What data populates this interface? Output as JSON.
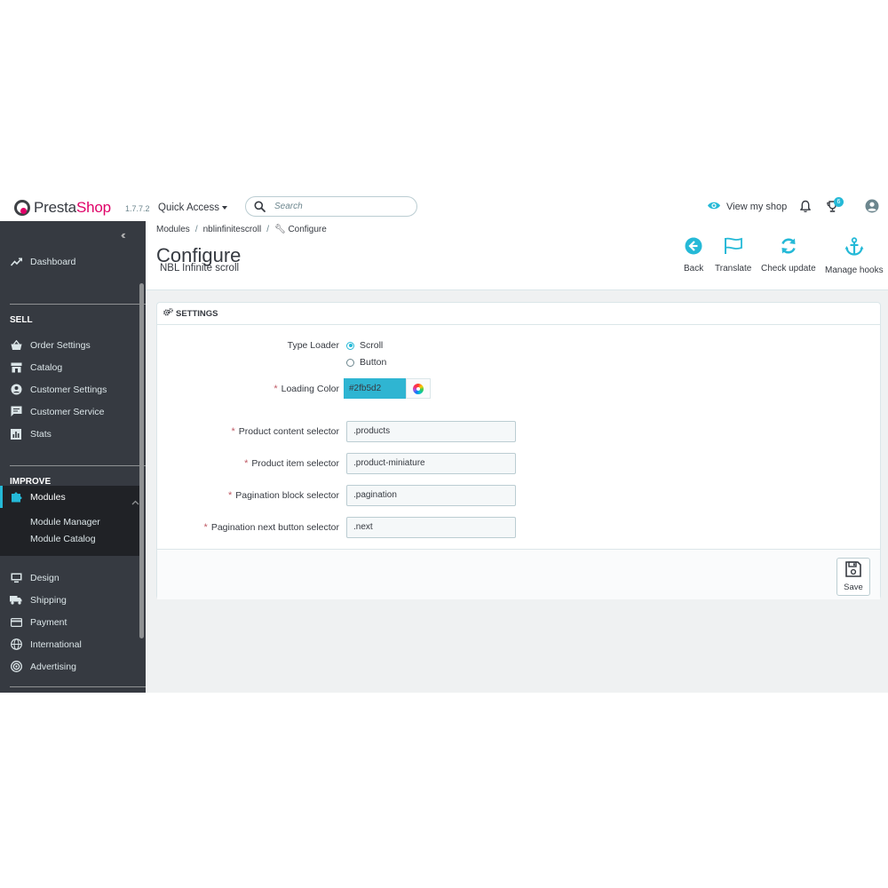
{
  "header": {
    "brand_prefix": "Presta",
    "brand_suffix": "Shop",
    "version": "1.7.7.2",
    "quick_access": "Quick Access",
    "search_placeholder": "Search",
    "view_shop": "View my shop",
    "notification_count": "6"
  },
  "sidebar": {
    "dashboard": "Dashboard",
    "sell_title": "SELL",
    "sell_items": [
      "Order Settings",
      "Catalog",
      "Customer Settings",
      "Customer Service",
      "Stats"
    ],
    "improve_title": "IMPROVE",
    "modules": "Modules",
    "module_sub": [
      "Module Manager",
      "Module Catalog"
    ],
    "improve_items": [
      "Design",
      "Shipping",
      "Payment",
      "International",
      "Advertising"
    ]
  },
  "toolbar": {
    "breadcrumb": [
      "Modules",
      "nblinfinitescroll",
      "Configure"
    ],
    "title": "Configure",
    "subtitle": "NBL Infinite scroll",
    "buttons": [
      "Back",
      "Translate",
      "Check update",
      "Manage hooks"
    ]
  },
  "panel": {
    "heading": "SETTINGS",
    "type_loader_label": "Type Loader",
    "type_loader_options": [
      "Scroll",
      "Button"
    ],
    "type_loader_selected": "Scroll",
    "loading_color_label": "Loading Color",
    "loading_color_value": "#2fb5d2",
    "fields": [
      {
        "label": "Product content selector",
        "value": ".products"
      },
      {
        "label": "Product item selector",
        "value": ".product-miniature"
      },
      {
        "label": "Pagination block selector",
        "value": ".pagination"
      },
      {
        "label": "Pagination next button selector",
        "value": ".next"
      }
    ],
    "save": "Save"
  },
  "colors": {
    "accent": "#25b9d7",
    "brand_pink": "#df0067",
    "sidebar_bg": "#363a41",
    "required": "#c05c67"
  }
}
